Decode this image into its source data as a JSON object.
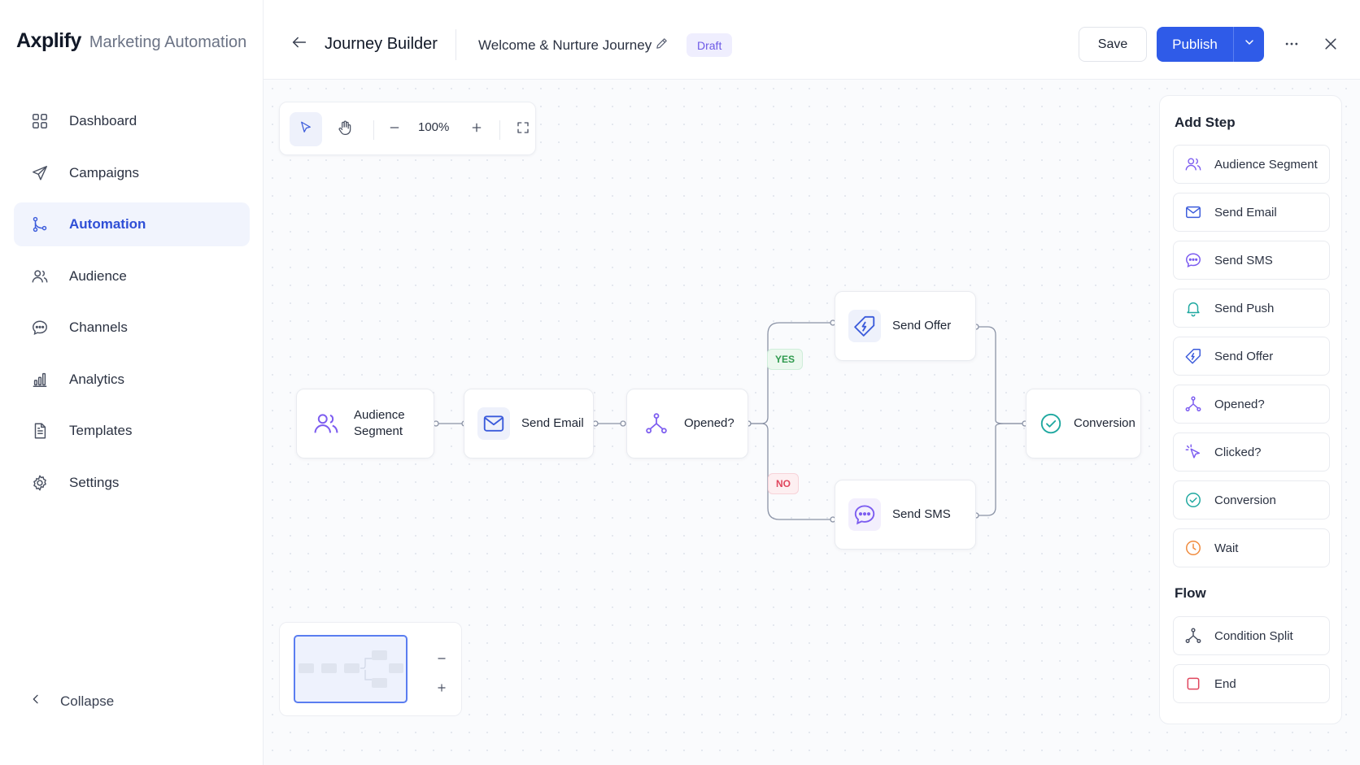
{
  "brand": {
    "name": "Axplify",
    "subtitle": "Marketing Automation"
  },
  "sidebar": {
    "items": [
      {
        "label": "Dashboard",
        "icon": "grid-icon",
        "active": false
      },
      {
        "label": "Campaigns",
        "icon": "paper-plane-icon",
        "active": false
      },
      {
        "label": "Automation",
        "icon": "git-branch-icon",
        "active": true
      },
      {
        "label": "Audience",
        "icon": "users-icon",
        "active": false
      },
      {
        "label": "Channels",
        "icon": "chat-bubble-icon",
        "active": false
      },
      {
        "label": "Analytics",
        "icon": "bar-chart-icon",
        "active": false
      },
      {
        "label": "Templates",
        "icon": "document-icon",
        "active": false
      },
      {
        "label": "Settings",
        "icon": "gear-icon",
        "active": false
      }
    ],
    "collapse_label": "Collapse"
  },
  "header": {
    "title": "Journey Builder",
    "journey_name": "Welcome & Nurture Journey",
    "status_badge": "Draft",
    "save_label": "Save",
    "publish_label": "Publish"
  },
  "toolbar": {
    "zoom": "100%"
  },
  "nodes": {
    "audience_segment": "Audience Segment",
    "send_email": "Send Email",
    "opened": "Opened?",
    "send_offer": "Send Offer",
    "send_sms": "Send SMS",
    "conversion": "Conversion"
  },
  "branches": {
    "yes": "YES",
    "no": "NO"
  },
  "panel": {
    "title": "Add Step",
    "steps": [
      {
        "label": "Audience Segment",
        "icon": "users-icon",
        "color": "#7c5cf0"
      },
      {
        "label": "Send Email",
        "icon": "mail-icon",
        "color": "#3b5bdb"
      },
      {
        "label": "Send SMS",
        "icon": "message-icon",
        "color": "#7c5cf0"
      },
      {
        "label": "Send Push",
        "icon": "bell-icon",
        "color": "#1fa8a0"
      },
      {
        "label": "Send Offer",
        "icon": "tag-icon",
        "color": "#3b5bdb"
      },
      {
        "label": "Opened?",
        "icon": "split-icon",
        "color": "#7c5cf0"
      },
      {
        "label": "Clicked?",
        "icon": "cursor-click-icon",
        "color": "#7c5cf0"
      },
      {
        "label": "Conversion",
        "icon": "check-circle-icon",
        "color": "#1fa8a0"
      },
      {
        "label": "Wait",
        "icon": "clock-icon",
        "color": "#f08a3c"
      }
    ],
    "flow_title": "Flow",
    "flow_steps": [
      {
        "label": "Condition Split",
        "icon": "split-icon",
        "color": "#4b5263"
      },
      {
        "label": "End",
        "icon": "stop-square-icon",
        "color": "#e0455d"
      }
    ]
  },
  "colors": {
    "accent": "#2f5be8",
    "purple": "#7c5cf0",
    "teal": "#1fa8a0",
    "orange": "#f08a3c",
    "red": "#e0455d",
    "green": "#2f9a4e"
  }
}
